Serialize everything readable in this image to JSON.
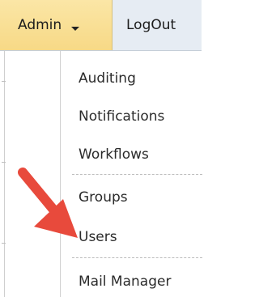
{
  "nav": {
    "admin_label": "Admin",
    "logout_label": "LogOut"
  },
  "menu": {
    "items": [
      {
        "label": "Auditing"
      },
      {
        "label": "Notifications"
      },
      {
        "label": "Workflows"
      },
      {
        "label": "Groups"
      },
      {
        "label": "Users"
      },
      {
        "label": "Mail Manager"
      }
    ]
  },
  "colors": {
    "admin_tab": "#f7d986",
    "navbar": "#e6ecf3",
    "arrow": "#e84a3c"
  }
}
